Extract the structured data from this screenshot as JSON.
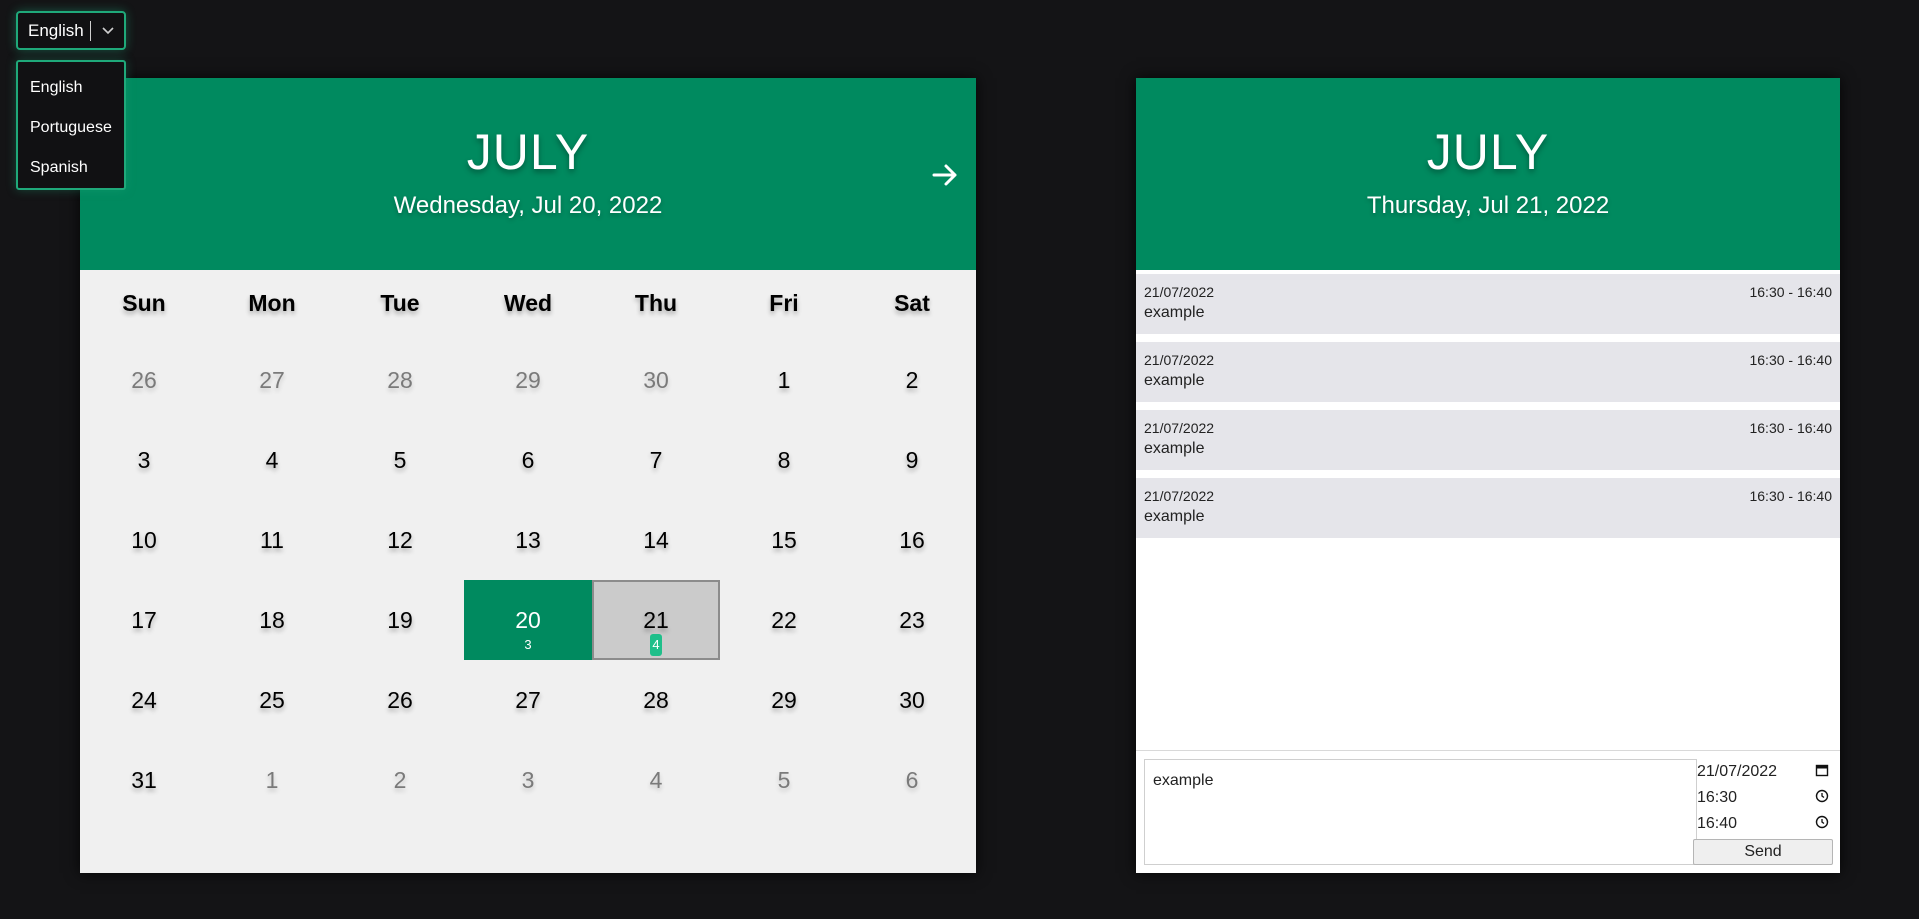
{
  "language": {
    "selected": "English",
    "options": [
      "English",
      "Portuguese",
      "Spanish"
    ]
  },
  "calendar": {
    "month": "JULY",
    "date_label": "Wednesday, Jul 20, 2022",
    "weekdays": [
      "Sun",
      "Mon",
      "Tue",
      "Wed",
      "Thu",
      "Fri",
      "Sat"
    ],
    "days": [
      {
        "n": "26",
        "muted": true
      },
      {
        "n": "27",
        "muted": true
      },
      {
        "n": "28",
        "muted": true
      },
      {
        "n": "29",
        "muted": true
      },
      {
        "n": "30",
        "muted": true
      },
      {
        "n": "1"
      },
      {
        "n": "2"
      },
      {
        "n": "3"
      },
      {
        "n": "4"
      },
      {
        "n": "5"
      },
      {
        "n": "6"
      },
      {
        "n": "7"
      },
      {
        "n": "8"
      },
      {
        "n": "9"
      },
      {
        "n": "10"
      },
      {
        "n": "11"
      },
      {
        "n": "12"
      },
      {
        "n": "13"
      },
      {
        "n": "14"
      },
      {
        "n": "15"
      },
      {
        "n": "16"
      },
      {
        "n": "17"
      },
      {
        "n": "18"
      },
      {
        "n": "19"
      },
      {
        "n": "20",
        "state": "selected",
        "count": "3"
      },
      {
        "n": "21",
        "state": "highlighted",
        "count": "4"
      },
      {
        "n": "22"
      },
      {
        "n": "23"
      },
      {
        "n": "24"
      },
      {
        "n": "25"
      },
      {
        "n": "26"
      },
      {
        "n": "27"
      },
      {
        "n": "28"
      },
      {
        "n": "29"
      },
      {
        "n": "30"
      },
      {
        "n": "31"
      },
      {
        "n": "1",
        "muted": true
      },
      {
        "n": "2",
        "muted": true
      },
      {
        "n": "3",
        "muted": true
      },
      {
        "n": "4",
        "muted": true
      },
      {
        "n": "5",
        "muted": true
      },
      {
        "n": "6",
        "muted": true
      }
    ],
    "next_icon": "arrow-right-icon"
  },
  "events_panel": {
    "month": "JULY",
    "date_label": "Thursday, Jul 21, 2022",
    "events": [
      {
        "date": "21/07/2022",
        "time": "16:30 - 16:40",
        "text": "example"
      },
      {
        "date": "21/07/2022",
        "time": "16:30 - 16:40",
        "text": "example"
      },
      {
        "date": "21/07/2022",
        "time": "16:30 - 16:40",
        "text": "example"
      },
      {
        "date": "21/07/2022",
        "time": "16:30 - 16:40",
        "text": "example"
      }
    ]
  },
  "composer": {
    "text": "example",
    "date": "21/07/2022",
    "start_time": "16:30",
    "end_time": "16:40",
    "send_label": "Send"
  },
  "colors": {
    "accent": "#008a5f",
    "accent_light": "#1fbf8a",
    "background": "#141416"
  }
}
